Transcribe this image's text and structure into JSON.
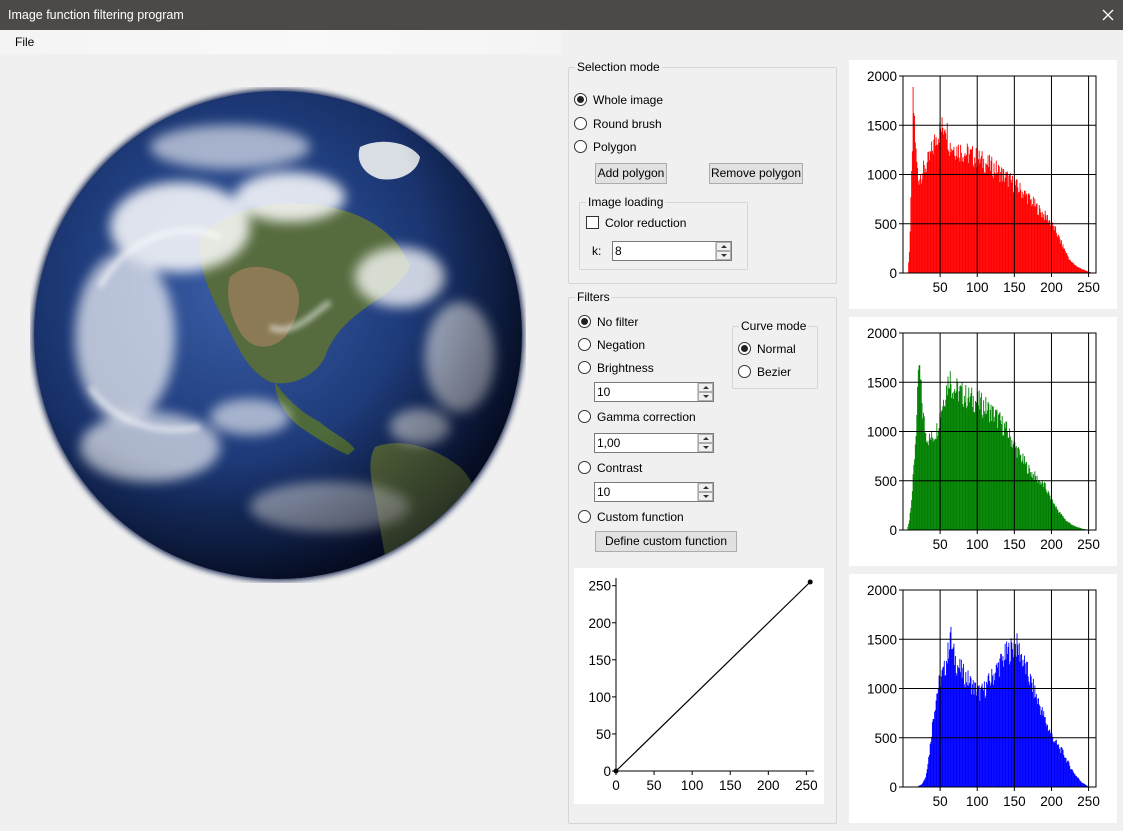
{
  "window": {
    "title": "Image function filtering program"
  },
  "menu": {
    "file": "File"
  },
  "image": {
    "subject": "Earth globe (Western hemisphere)"
  },
  "selection_mode": {
    "legend": "Selection mode",
    "options": [
      "Whole image",
      "Round brush",
      "Polygon"
    ],
    "selected": "Whole image",
    "add_polygon": "Add polygon",
    "remove_polygon": "Remove polygon",
    "image_loading": {
      "legend": "Image loading",
      "color_reduction": "Color reduction",
      "color_reduction_checked": false,
      "k_label": "k:",
      "k_value": "8"
    }
  },
  "filters": {
    "legend": "Filters",
    "no_filter": "No filter",
    "negation": "Negation",
    "brightness": "Brightness",
    "brightness_value": "10",
    "gamma": "Gamma correction",
    "gamma_value": "1,00",
    "contrast": "Contrast",
    "contrast_value": "10",
    "custom": "Custom function",
    "define_custom": "Define custom function",
    "selected": "No filter",
    "curve_mode": {
      "legend": "Curve mode",
      "normal": "Normal",
      "bezier": "Bezier",
      "selected": "Normal"
    }
  },
  "chart_data": [
    {
      "type": "line",
      "x": [
        0,
        255
      ],
      "y": [
        0,
        255
      ],
      "xlim": [
        0,
        260
      ],
      "ylim": [
        0,
        255
      ],
      "xticks": [
        "0",
        "50",
        "100",
        "150",
        "200",
        "250"
      ],
      "yticks": [
        "0",
        "50",
        "100",
        "150",
        "200",
        "250"
      ],
      "color": "#000000"
    },
    {
      "type": "bar",
      "color": "#ff0000",
      "x_range": [
        0,
        255
      ],
      "xlim": [
        0,
        260
      ],
      "ylim": [
        0,
        2000
      ],
      "xticks": [
        "50",
        "100",
        "150",
        "200",
        "250"
      ],
      "yticks": [
        "0",
        "500",
        "1000",
        "1500",
        "2000"
      ],
      "profile": [
        [
          0,
          0
        ],
        [
          6,
          0
        ],
        [
          8,
          200
        ],
        [
          10,
          700
        ],
        [
          12,
          1250
        ],
        [
          13,
          1740
        ],
        [
          15,
          1550
        ],
        [
          17,
          1200
        ],
        [
          20,
          950
        ],
        [
          23,
          1000
        ],
        [
          28,
          1050
        ],
        [
          35,
          1150
        ],
        [
          40,
          1280
        ],
        [
          45,
          1400
        ],
        [
          50,
          1450
        ],
        [
          55,
          1500
        ],
        [
          56,
          1560
        ],
        [
          58,
          1480
        ],
        [
          62,
          1300
        ],
        [
          70,
          1270
        ],
        [
          80,
          1230
        ],
        [
          95,
          1180
        ],
        [
          110,
          1120
        ],
        [
          125,
          1050
        ],
        [
          140,
          960
        ],
        [
          155,
          860
        ],
        [
          170,
          750
        ],
        [
          185,
          620
        ],
        [
          195,
          550
        ],
        [
          205,
          430
        ],
        [
          215,
          270
        ],
        [
          225,
          120
        ],
        [
          235,
          60
        ],
        [
          245,
          25
        ],
        [
          255,
          0
        ]
      ]
    },
    {
      "type": "bar",
      "color": "#008000",
      "x_range": [
        0,
        255
      ],
      "xlim": [
        0,
        260
      ],
      "ylim": [
        0,
        2000
      ],
      "xticks": [
        "50",
        "100",
        "150",
        "200",
        "250"
      ],
      "yticks": [
        "0",
        "500",
        "1000",
        "1500",
        "2000"
      ],
      "profile": [
        [
          0,
          0
        ],
        [
          5,
          0
        ],
        [
          8,
          100
        ],
        [
          12,
          400
        ],
        [
          15,
          750
        ],
        [
          18,
          1150
        ],
        [
          20,
          1500
        ],
        [
          21,
          1680
        ],
        [
          23,
          1500
        ],
        [
          26,
          1200
        ],
        [
          30,
          980
        ],
        [
          35,
          920
        ],
        [
          40,
          950
        ],
        [
          45,
          1020
        ],
        [
          50,
          1200
        ],
        [
          55,
          1350
        ],
        [
          60,
          1500
        ],
        [
          62,
          1580
        ],
        [
          65,
          1460
        ],
        [
          75,
          1400
        ],
        [
          85,
          1350
        ],
        [
          95,
          1320
        ],
        [
          110,
          1250
        ],
        [
          125,
          1150
        ],
        [
          140,
          1000
        ],
        [
          150,
          850
        ],
        [
          160,
          720
        ],
        [
          170,
          600
        ],
        [
          180,
          520
        ],
        [
          190,
          450
        ],
        [
          200,
          300
        ],
        [
          210,
          180
        ],
        [
          220,
          90
        ],
        [
          230,
          40
        ],
        [
          240,
          15
        ],
        [
          250,
          0
        ]
      ]
    },
    {
      "type": "bar",
      "color": "#0000ff",
      "x_range": [
        0,
        255
      ],
      "xlim": [
        0,
        260
      ],
      "ylim": [
        0,
        2000
      ],
      "xticks": [
        "50",
        "100",
        "150",
        "200",
        "250"
      ],
      "yticks": [
        "0",
        "500",
        "1000",
        "1500",
        "2000"
      ],
      "profile": [
        [
          0,
          0
        ],
        [
          18,
          0
        ],
        [
          25,
          30
        ],
        [
          30,
          100
        ],
        [
          35,
          350
        ],
        [
          40,
          700
        ],
        [
          45,
          950
        ],
        [
          50,
          1100
        ],
        [
          55,
          1180
        ],
        [
          60,
          1350
        ],
        [
          63,
          1570
        ],
        [
          66,
          1380
        ],
        [
          72,
          1250
        ],
        [
          80,
          1150
        ],
        [
          88,
          1080
        ],
        [
          96,
          1000
        ],
        [
          104,
          950
        ],
        [
          110,
          1000
        ],
        [
          120,
          1120
        ],
        [
          130,
          1250
        ],
        [
          140,
          1360
        ],
        [
          148,
          1420
        ],
        [
          152,
          1440
        ],
        [
          158,
          1350
        ],
        [
          165,
          1200
        ],
        [
          175,
          1000
        ],
        [
          185,
          800
        ],
        [
          195,
          600
        ],
        [
          205,
          450
        ],
        [
          215,
          350
        ],
        [
          225,
          200
        ],
        [
          232,
          120
        ],
        [
          240,
          50
        ],
        [
          250,
          0
        ]
      ]
    }
  ]
}
